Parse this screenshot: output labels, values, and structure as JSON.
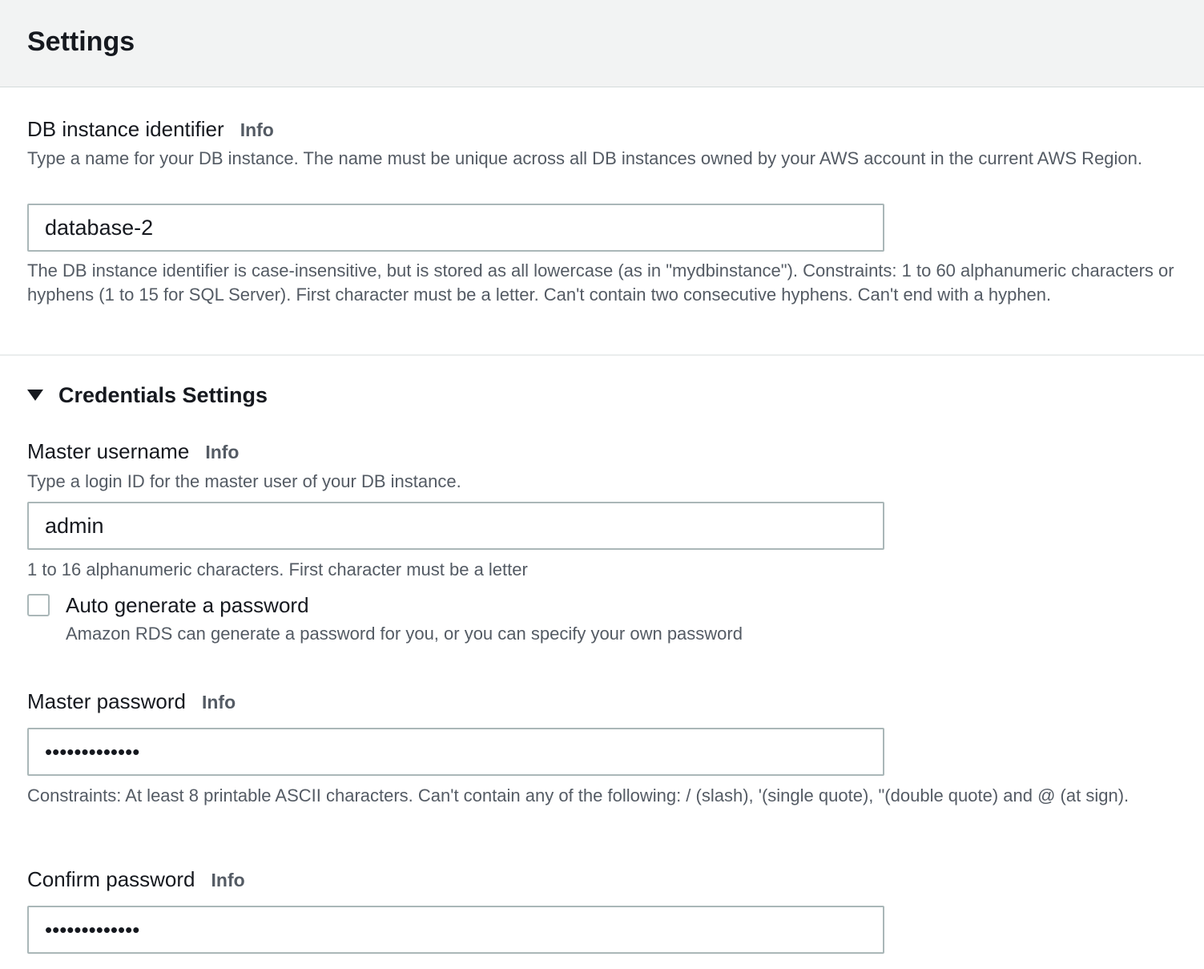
{
  "header": {
    "title": "Settings"
  },
  "db_identifier": {
    "label": "DB instance identifier",
    "info": "Info",
    "description": "Type a name for your DB instance. The name must be unique across all DB instances owned by your AWS account in the current AWS Region.",
    "value": "database-2",
    "constraint": "The DB instance identifier is case-insensitive, but is stored as all lowercase (as in \"mydbinstance\"). Constraints: 1 to 60 alphanumeric characters or hyphens (1 to 15 for SQL Server). First character must be a letter. Can't contain two consecutive hyphens. Can't end with a hyphen."
  },
  "credentials": {
    "section_title": "Credentials Settings",
    "master_username": {
      "label": "Master username",
      "info": "Info",
      "description": "Type a login ID for the master user of your DB instance.",
      "value": "admin",
      "constraint": "1 to 16 alphanumeric characters. First character must be a letter"
    },
    "auto_generate": {
      "label": "Auto generate a password",
      "description": "Amazon RDS can generate a password for you, or you can specify your own password",
      "checked": false
    },
    "master_password": {
      "label": "Master password",
      "info": "Info",
      "value": "•••••••••••••",
      "constraint": "Constraints: At least 8 printable ASCII characters. Can't contain any of the following: / (slash), '(single quote), \"(double quote) and @ (at sign)."
    },
    "confirm_password": {
      "label": "Confirm password",
      "info": "Info",
      "value": "•••••••••••••"
    }
  }
}
